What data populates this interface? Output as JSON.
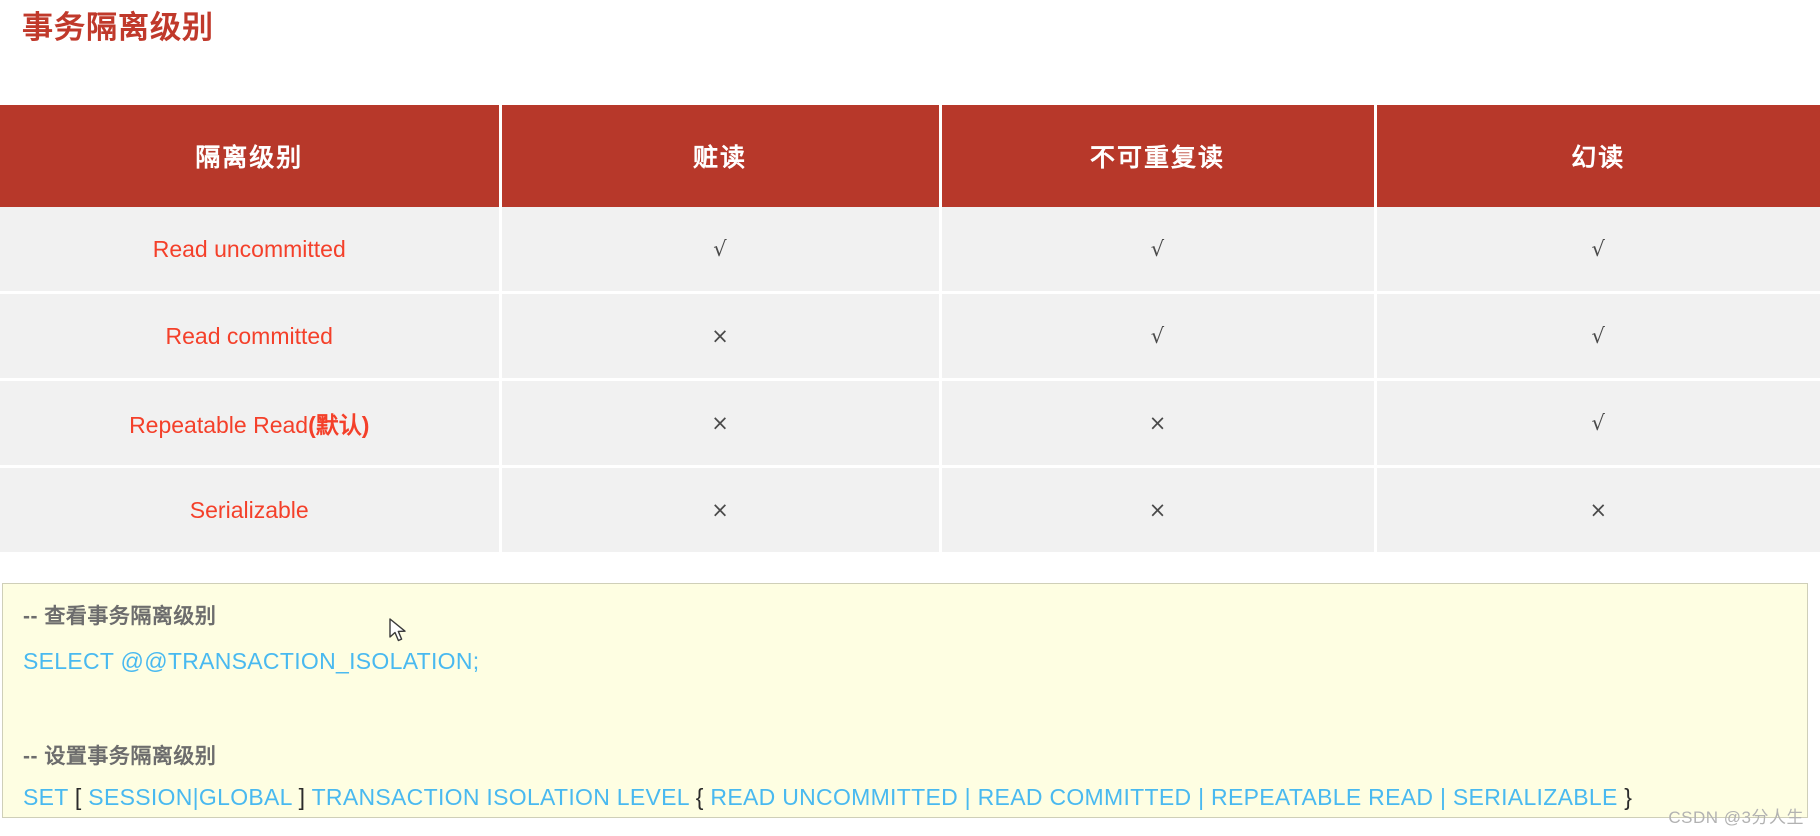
{
  "page": {
    "title": "事务隔离级别",
    "title_color": "#c0392b"
  },
  "table": {
    "header_bg": "#b7382a",
    "header_text_color": "#ffffff",
    "row_bg": "#f1f1f1",
    "level_text_color": "#f4402a",
    "columns": [
      "隔离级别",
      "赃读",
      "不可重复读",
      "幻读"
    ],
    "rows": [
      {
        "level": "Read uncommitted",
        "level_suffix": "",
        "dirty_read": "√",
        "non_repeatable_read": "√",
        "phantom_read": "√"
      },
      {
        "level": "Read committed",
        "level_suffix": "",
        "dirty_read": "×",
        "non_repeatable_read": "√",
        "phantom_read": "√"
      },
      {
        "level": "Repeatable Read",
        "level_suffix": "(默认)",
        "dirty_read": "×",
        "non_repeatable_read": "×",
        "phantom_read": "√"
      },
      {
        "level": "Serializable",
        "level_suffix": "",
        "dirty_read": "×",
        "non_repeatable_read": "×",
        "phantom_read": "×"
      }
    ]
  },
  "code_block": {
    "bg": "#fefee2",
    "comment_color": "#6d6d6d",
    "sql_color": "#49b9f0",
    "punctuation_color": "#2b2b2b",
    "line1_comment": "-- 查看事务隔离级别",
    "line2_sql": "SELECT @@TRANSACTION_ISOLATION;",
    "line3_comment": "-- 设置事务隔离级别",
    "line4_sql_part1": "SET  ",
    "line4_bracket_open": "[",
    "line4_sql_part2": " SESSION|GLOBAL ",
    "line4_bracket_close": "]",
    "line4_sql_part3": "  TRANSACTION   ISOLATION   LEVEL   ",
    "line4_brace_open": "{",
    "line4_sql_part4": " READ UNCOMMITTED  |  READ COMMITTED  |  REPEATABLE READ  |  SERIALIZABLE ",
    "line4_brace_close": "}"
  },
  "watermark": {
    "text": "CSDN @3分人生"
  }
}
